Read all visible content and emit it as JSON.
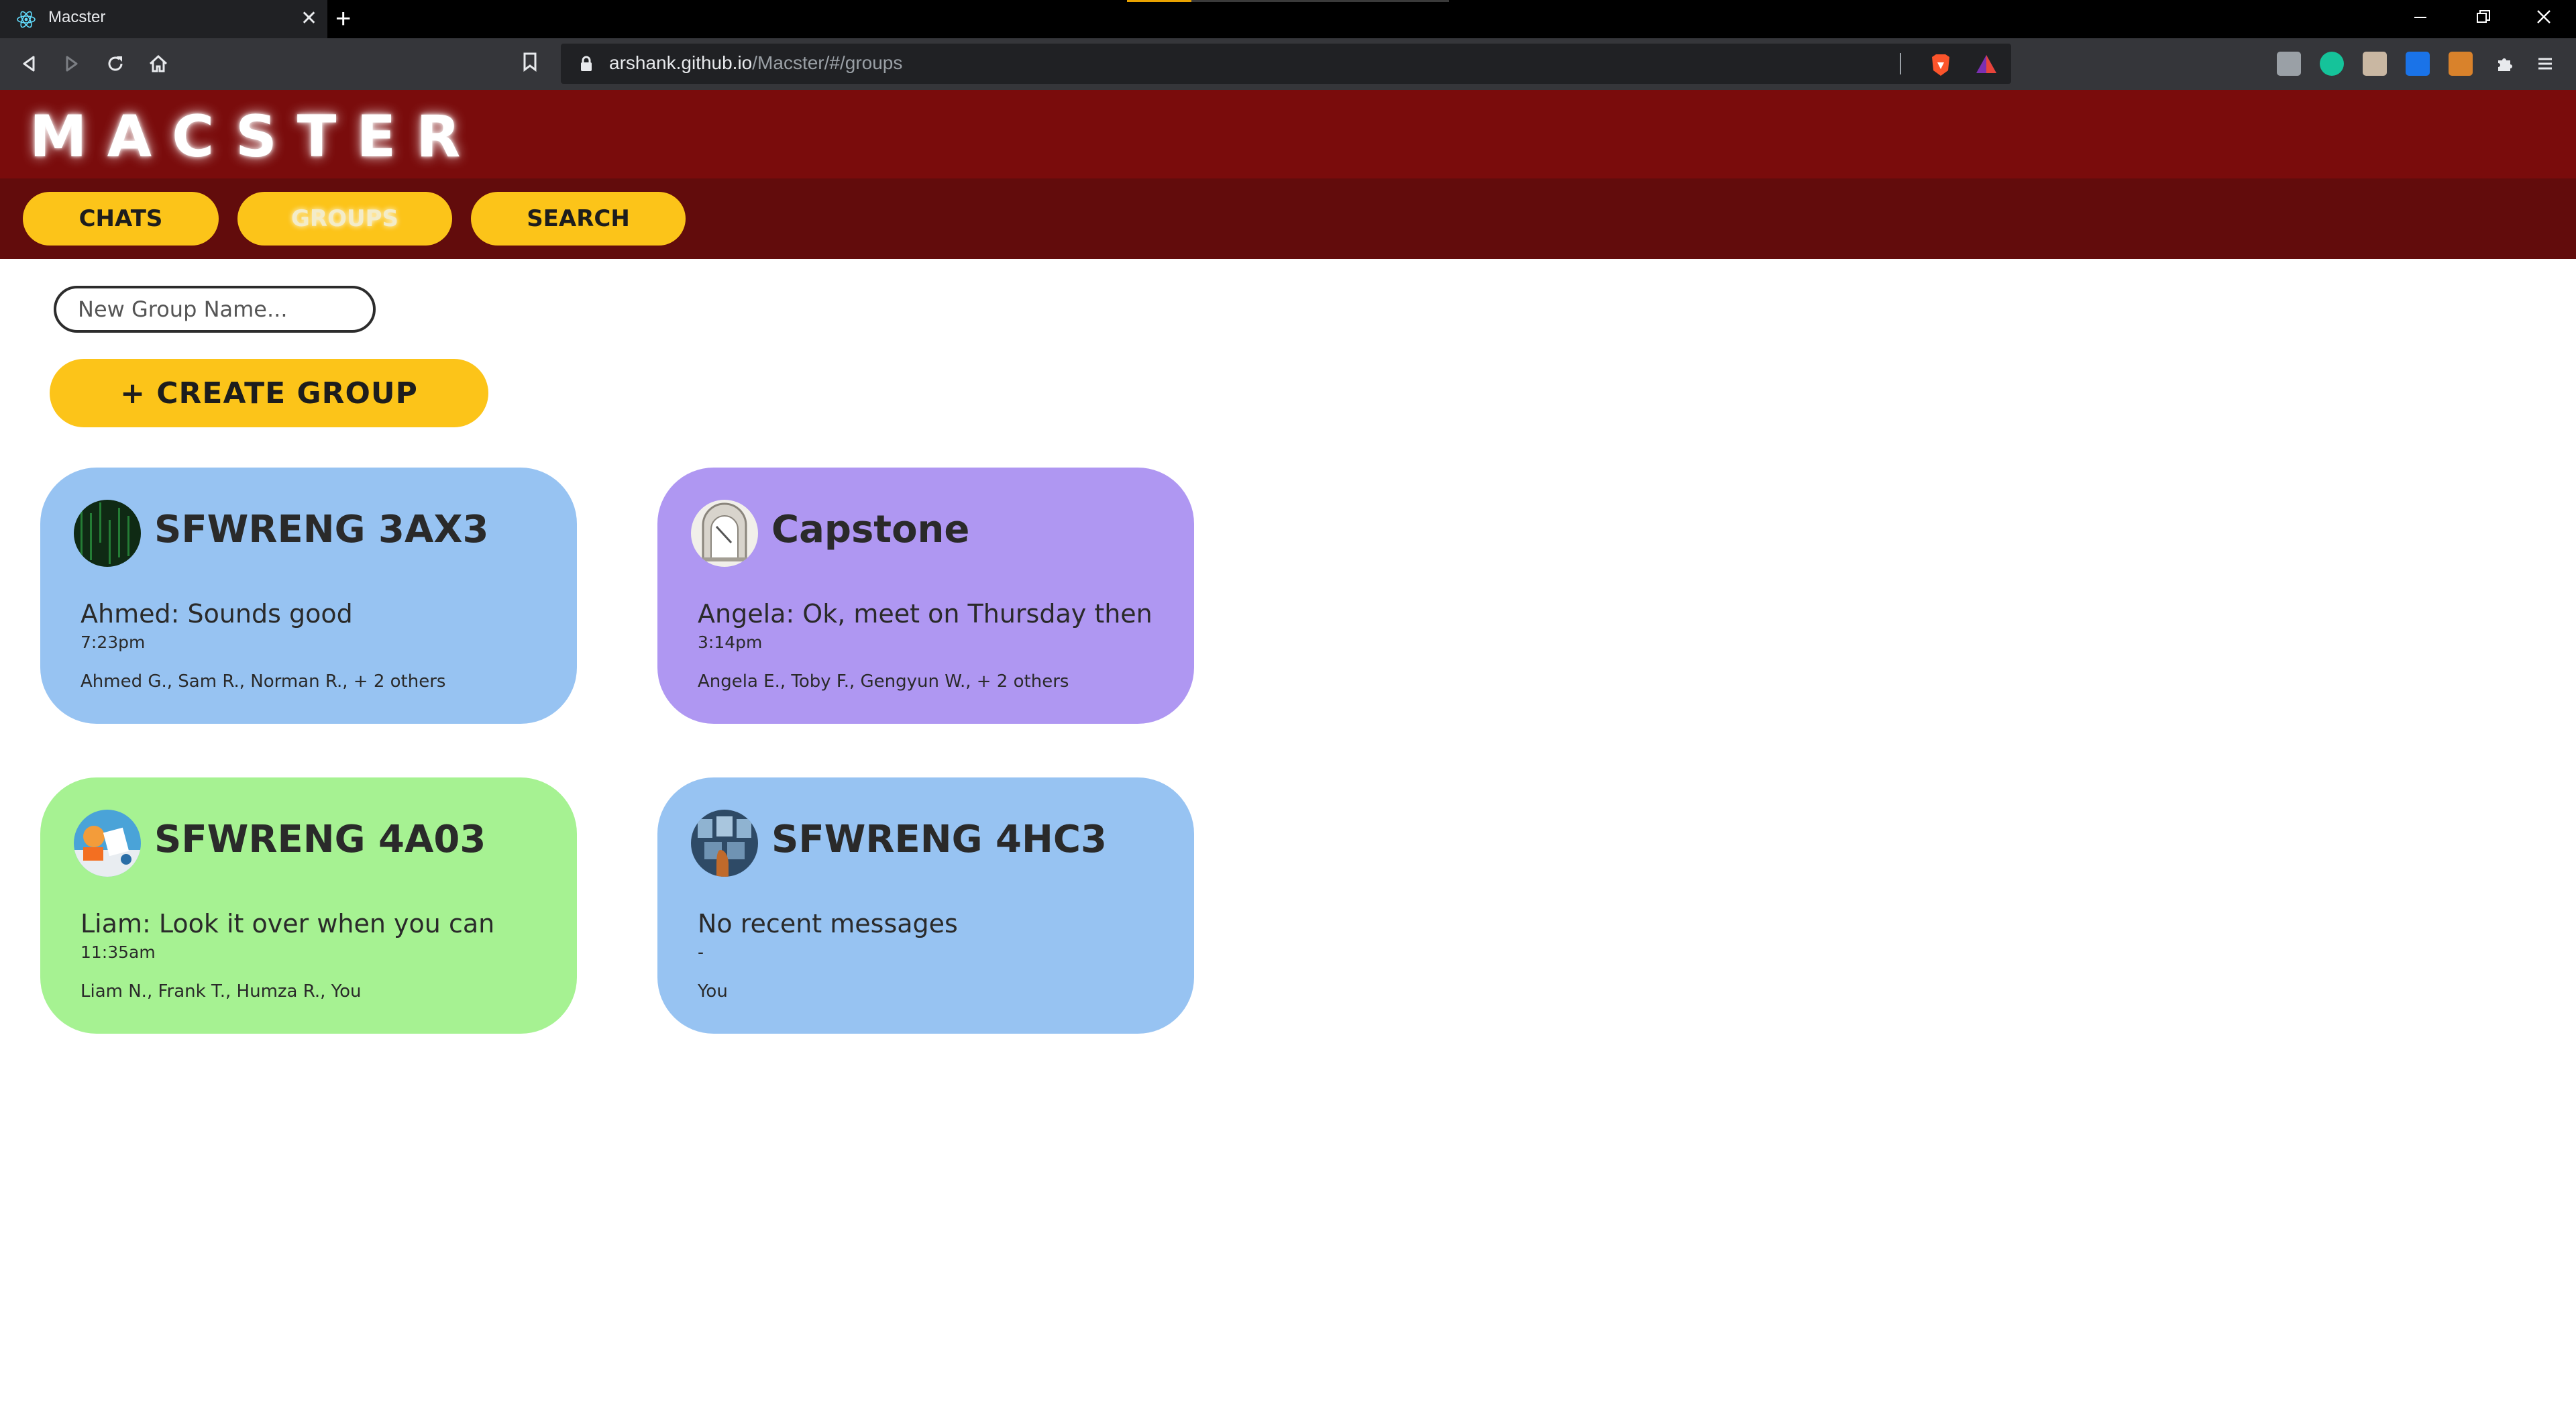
{
  "browser": {
    "tab_title": "Macster",
    "tab_close": "✕",
    "new_tab": "+",
    "url_host": "arshank.github.io",
    "url_path": "/Macster/#/groups"
  },
  "app": {
    "logo": "MACSTER",
    "nav": {
      "chats": "CHATS",
      "groups": "GROUPS",
      "search": "SEARCH",
      "active": "groups"
    },
    "new_group_placeholder": "New Group Name...",
    "create_group_label": "+ CREATE GROUP",
    "groups": [
      {
        "name": "SFWRENG 3AX3",
        "last_message": "Ahmed: Sounds good",
        "time": "7:23pm",
        "members": "Ahmed G., Sam R., Norman R., + 2 others",
        "color": "#97c3f2"
      },
      {
        "name": "Capstone",
        "last_message": "Angela: Ok, meet on Thursday then",
        "time": "3:14pm",
        "members": "Angela E., Toby F., Gengyun W., + 2 others",
        "color": "#af97f2"
      },
      {
        "name": "SFWRENG 4A03",
        "last_message": "Liam: Look it over when you can",
        "time": "11:35am",
        "members": "Liam N., Frank T., Humza R., You",
        "color": "#a6f292"
      },
      {
        "name": "SFWRENG 4HC3",
        "last_message": "No recent messages",
        "time": "-",
        "members": "You",
        "color": "#97c3f2"
      }
    ]
  },
  "colors": {
    "header": "#7a0c0c",
    "nav_bar": "#620c0c",
    "accent": "#fcc419"
  }
}
